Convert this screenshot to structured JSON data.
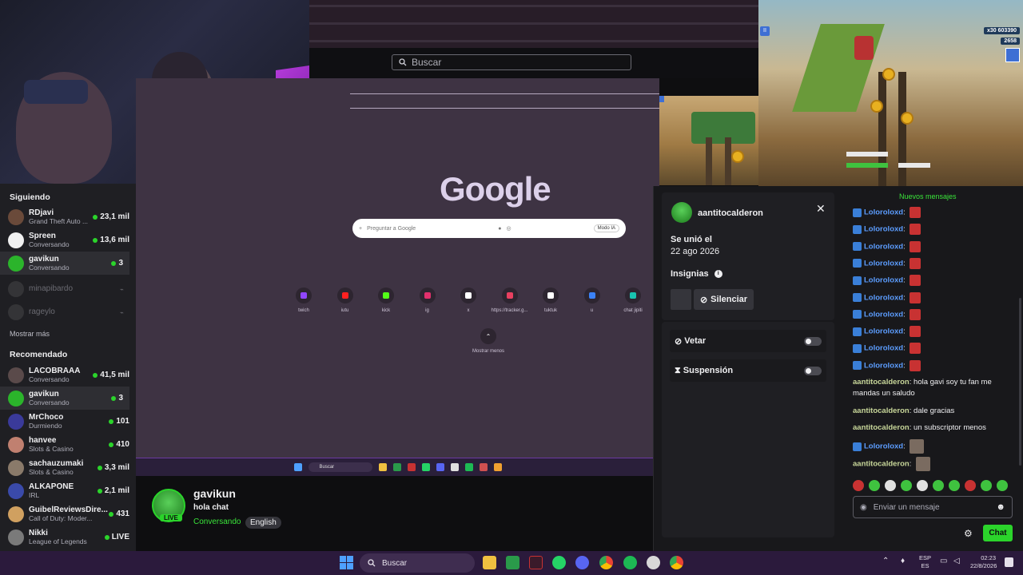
{
  "browser": {
    "search_placeholder": "Buscar"
  },
  "google": {
    "logo": "Google",
    "search_placeholder": "Preguntar a Google",
    "mode_label": "Modo IA",
    "shortcuts": [
      {
        "label": "twich",
        "color": "#9146ff"
      },
      {
        "label": "iutu",
        "color": "#ff2020"
      },
      {
        "label": "kick",
        "color": "#53fc18"
      },
      {
        "label": "ig",
        "color": "#e1306c"
      },
      {
        "label": "x",
        "color": "#ffffff"
      },
      {
        "label": "https://tracker.g...",
        "color": "#e84060"
      },
      {
        "label": "tuktuk",
        "color": "#ffffff"
      },
      {
        "label": "u",
        "color": "#3b82f6"
      },
      {
        "label": "chat jipiti",
        "color": "#19c3b0"
      }
    ],
    "show_less": "Mostrar menos",
    "taskbar_search": "Buscar"
  },
  "game": {
    "hud_score": "603390",
    "hud_multiplier": "x30",
    "hud_coins": "2658"
  },
  "sidebar": {
    "following_heading": "Siguiendo",
    "following": [
      {
        "name": "RDjavi",
        "sub": "Grand Theft Auto ...",
        "count": "23,1 mil",
        "avatar_color": "#6a4a3a"
      },
      {
        "name": "Spreen",
        "sub": "Conversando",
        "count": "13,6 mil",
        "avatar_color": "#f0f0f0"
      },
      {
        "name": "gavikun",
        "sub": "Conversando",
        "count": "3",
        "avatar_color": "#2bb42b"
      }
    ],
    "offline": [
      {
        "name": "minapibardo"
      },
      {
        "name": "rageylo"
      }
    ],
    "show_more": "Mostrar más",
    "recommended_heading": "Recomendado",
    "recommended": [
      {
        "name": "LACOBRAAA",
        "sub": "Conversando",
        "count": "41,5 mil",
        "avatar_color": "#5a4a4a"
      },
      {
        "name": "gavikun",
        "sub": "Conversando",
        "count": "3",
        "avatar_color": "#2bb42b"
      },
      {
        "name": "MrChoco",
        "sub": "Durmiendo",
        "count": "101",
        "avatar_color": "#3a3a9a"
      },
      {
        "name": "hanvee",
        "sub": "Slots & Casino",
        "count": "410",
        "avatar_color": "#c08070"
      },
      {
        "name": "sachauzumaki",
        "sub": "Slots & Casino",
        "count": "3,3 mil",
        "avatar_color": "#8a7a6a"
      },
      {
        "name": "ALKAPONE",
        "sub": "IRL",
        "count": "2,1 mil",
        "avatar_color": "#3a4aaa"
      },
      {
        "name": "GuibelReviewsDire...",
        "sub": "Call of Duty: Moder...",
        "count": "431",
        "avatar_color": "#d0a060"
      },
      {
        "name": "Nikki",
        "sub": "League of Legends",
        "count": "LIVE",
        "avatar_color": "#7a7a7a"
      }
    ],
    "recommended_extra_sub": "Slots & Casino"
  },
  "stream": {
    "channel": "gavikun",
    "title": "hola chat",
    "category": "Conversando",
    "tag": "English",
    "live_label": "LIVE"
  },
  "usercard": {
    "username": "aantitocalderon",
    "joined_label": "Se unió el",
    "joined_date": "22 ago 2026",
    "badges_label": "Insignias",
    "mute_label": "Silenciar",
    "ban_label": "Vetar",
    "timeout_label": "Suspensión"
  },
  "chat": {
    "new_messages": "Nuevos mensajes",
    "messages": [
      {
        "user": "Loloroloxd",
        "text": "",
        "emote": "red"
      },
      {
        "user": "Loloroloxd",
        "text": "",
        "emote": "red"
      },
      {
        "user": "Loloroloxd",
        "text": "",
        "emote": "red"
      },
      {
        "user": "Loloroloxd",
        "text": "",
        "emote": "red"
      },
      {
        "user": "Loloroloxd",
        "text": "",
        "emote": "red"
      },
      {
        "user": "Loloroloxd",
        "text": "",
        "emote": "red"
      },
      {
        "user": "Loloroloxd",
        "text": "",
        "emote": "red"
      },
      {
        "user": "Loloroloxd",
        "text": "",
        "emote": "red"
      },
      {
        "user": "Loloroloxd",
        "text": "",
        "emote": "red"
      },
      {
        "user": "Loloroloxd",
        "text": "",
        "emote": "red"
      },
      {
        "user": "aantitocalderon",
        "text": "hola gavi soy tu fan me mandas un saludo",
        "emote": ""
      },
      {
        "user": "aantitocalderon",
        "text": "dale gracias",
        "emote": ""
      },
      {
        "user": "aantitocalderon",
        "text": "un subscriptor menos",
        "emote": ""
      },
      {
        "user": "Loloroloxd",
        "text": "",
        "emote": "img"
      },
      {
        "user": "aantitocalderon",
        "text": "",
        "emote": "img"
      }
    ],
    "input_placeholder": "Enviar un mensaje",
    "send_label": "Chat"
  },
  "taskbar": {
    "search_placeholder": "Buscar",
    "lang_top": "ESP",
    "lang_bottom": "ES",
    "time": "02:23",
    "date": "22/8/2026"
  }
}
